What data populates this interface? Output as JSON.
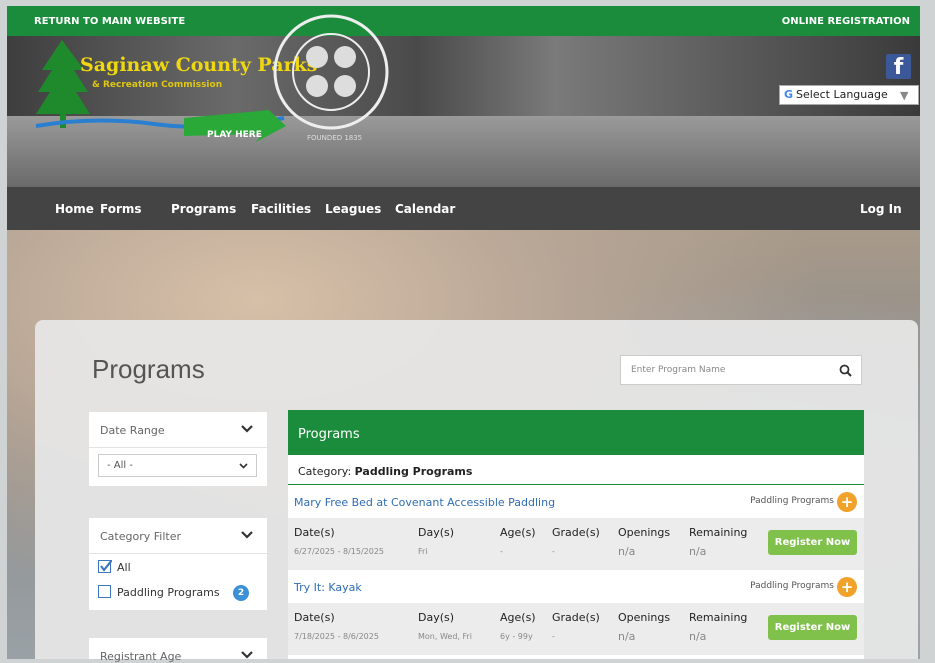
{
  "top_bar": {
    "return_link": "RETURN TO MAIN WEBSITE",
    "online_registration": "ONLINE REGISTRATION"
  },
  "header": {
    "logo_name": "Saginaw County Parks",
    "logo_subtitle": "& Recreation Commission",
    "logo_tagline": "PLAY HERE",
    "seal_text": "FOUNDED 1835",
    "facebook_icon": "facebook-icon",
    "language_label": "Select Language",
    "language_caret": "▼"
  },
  "nav": {
    "items": [
      "Home",
      "Forms",
      "Programs",
      "Facilities",
      "Leagues",
      "Calendar"
    ],
    "login": "Log In"
  },
  "page": {
    "title": "Programs",
    "search_placeholder": "Enter Program Name"
  },
  "filters": {
    "date_range": {
      "label": "Date Range",
      "selected": "- All -"
    },
    "category": {
      "label": "Category Filter",
      "options": [
        {
          "label": "All",
          "checked": true
        },
        {
          "label": "Paddling Programs",
          "checked": false,
          "count": "2"
        }
      ]
    },
    "registrant_age": {
      "label": "Registrant Age"
    }
  },
  "programs": {
    "header": "Programs",
    "category_prefix": "Category:",
    "category_value": "Paddling Programs",
    "columns": [
      "Date(s)",
      "Day(s)",
      "Age(s)",
      "Grade(s)",
      "Openings",
      "Remaining"
    ],
    "register_label": "Register Now",
    "items": [
      {
        "name": "Mary Free Bed at Covenant Accessible Paddling",
        "category_tag": "Paddling Programs",
        "dates": "6/27/2025 - 8/15/2025",
        "days": "Fri",
        "ages": "-",
        "grades": "-",
        "openings": "n/a",
        "remaining": "n/a"
      },
      {
        "name": "Try It: Kayak",
        "category_tag": "Paddling Programs",
        "dates": "7/18/2025 - 8/6/2025",
        "days": "Mon, Wed, Fri",
        "ages": "6y - 99y",
        "grades": "-",
        "openings": "n/a",
        "remaining": "n/a"
      }
    ]
  },
  "colors": {
    "brand_green": "#1b8c3c",
    "register_green": "#80c14c",
    "link_blue": "#2f6db5",
    "accent_orange": "#f0a22a"
  }
}
